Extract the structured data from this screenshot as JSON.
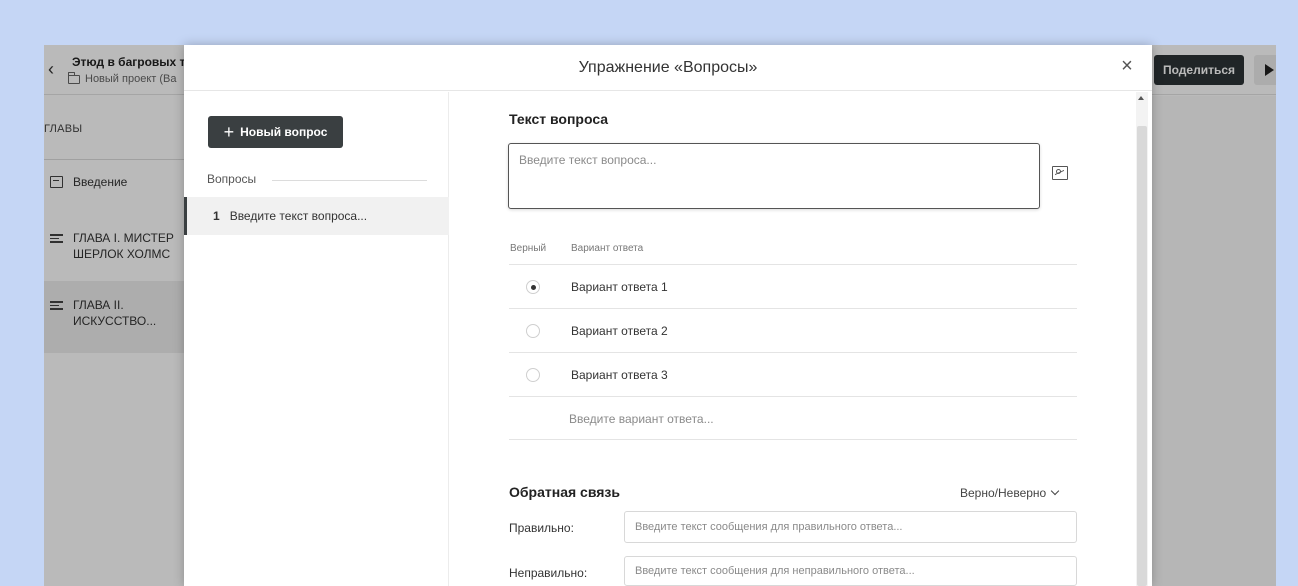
{
  "app": {
    "doc_title": "Этюд в багровых т",
    "doc_subtitle": "Новый проект (Ва",
    "share_label": "Поделиться",
    "chapters_heading": "ГЛАВЫ",
    "chapters": [
      {
        "label": "Введение",
        "icon": "document-icon"
      },
      {
        "label": "ГЛАВА I. МИСТЕР ШЕРЛОК ХОЛМС",
        "icon": "text-lines-icon"
      },
      {
        "label": "ГЛАВА II. ИСКУССТВО...",
        "icon": "text-lines-icon",
        "selected": true
      }
    ]
  },
  "modal": {
    "title": "Упражнение «Вопросы»",
    "close_glyph": "×",
    "new_question_label": "Новый вопрос",
    "questions_section_label": "Вопросы",
    "questions": [
      {
        "number": "1",
        "text": "Введите текст вопроса..."
      }
    ],
    "question_text_title": "Текст вопроса",
    "question_placeholder": "Введите текст вопроса...",
    "answers_header": {
      "correct": "Верный",
      "variant": "Вариант ответа"
    },
    "answers": [
      {
        "text": "Вариант ответа 1",
        "checked": true
      },
      {
        "text": "Вариант ответа 2",
        "checked": false
      },
      {
        "text": "Вариант ответа 3",
        "checked": false
      }
    ],
    "new_answer_placeholder": "Введите вариант ответа...",
    "feedback": {
      "title": "Обратная связь",
      "mode": "Верно/Неверно",
      "correct_label": "Правильно:",
      "correct_placeholder": "Введите текст сообщения для правильного ответа...",
      "incorrect_label": "Неправильно:",
      "incorrect_placeholder": "Введите текст сообщения для неправильного ответа..."
    }
  },
  "colors": {
    "page_background": "#c5d6f5",
    "dark_button": "#3a3f41",
    "accent_text": "#222222"
  }
}
